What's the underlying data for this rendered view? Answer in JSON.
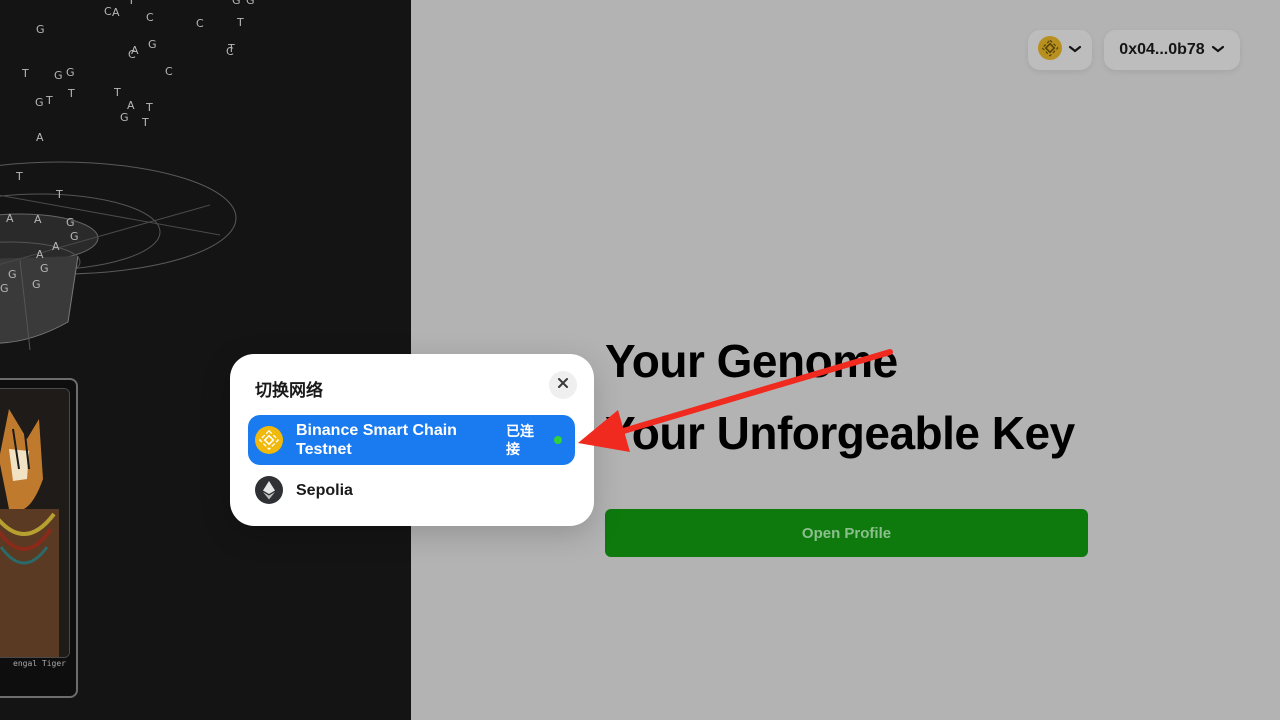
{
  "header": {
    "chain_icon": "bnb-chain-icon",
    "account_address": "0x04...0b78"
  },
  "hero": {
    "line1": "Your Genome",
    "line2": "Your Unforgeable Key"
  },
  "actions": {
    "open_profile_label": "Open Profile"
  },
  "art": {
    "nft_caption": "engal Tiger",
    "dna_letters": [
      "C",
      "A",
      "T",
      "G",
      "C",
      "C",
      "T",
      "G",
      "G",
      "C",
      "A",
      "G",
      "C",
      "C",
      "T",
      "T",
      "G",
      "G",
      "T",
      "G",
      "T",
      "T",
      "A",
      "T",
      "G",
      "T",
      "A",
      "T",
      "T",
      "A",
      "A",
      "G",
      "G",
      "A",
      "A",
      "G",
      "G",
      "G",
      "G"
    ]
  },
  "network_modal": {
    "title": "切换网络",
    "close_icon": "close-icon",
    "networks": [
      {
        "name": "Binance Smart Chain Testnet",
        "status": "已连接",
        "icon": "bnb-chain-icon",
        "active": true
      },
      {
        "name": "Sepolia",
        "status": "",
        "icon": "ethereum-icon",
        "active": false
      }
    ]
  },
  "colors": {
    "active_network_bg": "#1a7bf0",
    "open_profile_bg": "#0e7a0e",
    "connected_dot": "#33d03a",
    "annotation_arrow": "#f02a1e",
    "bnb_gold": "#f0b90b"
  }
}
